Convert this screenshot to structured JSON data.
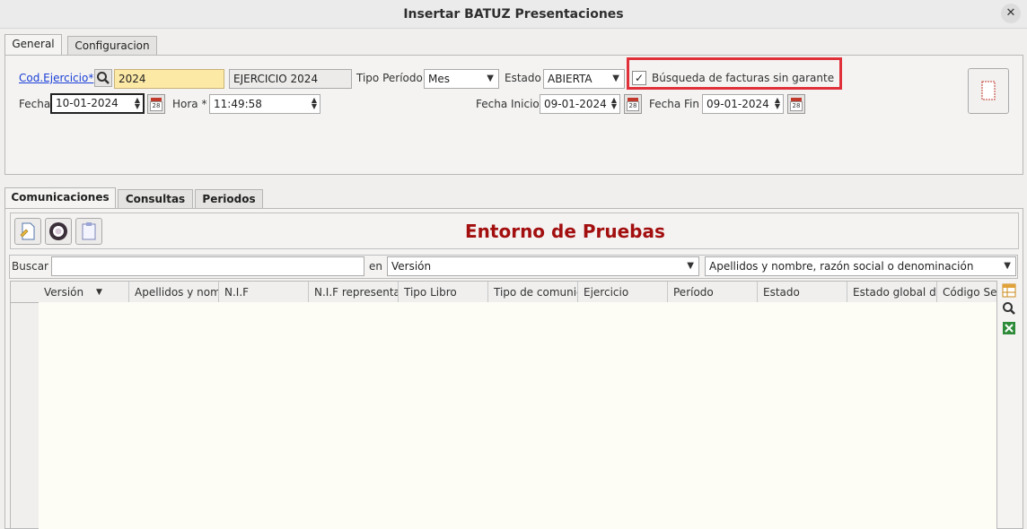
{
  "window": {
    "title": "Insertar BATUZ Presentaciones",
    "close": "✕"
  },
  "top_tabs": [
    "General",
    "Configuracion"
  ],
  "form": {
    "cod_ejercicio_label": "Cod.Ejercicio*",
    "cod_ejercicio_value": "2024",
    "ejercicio_desc": "EJERCICIO 2024",
    "tipo_periodo_label": "Tipo Período",
    "tipo_periodo_value": "Mes",
    "estado_label": "Estado",
    "estado_value": "ABIERTA",
    "busqueda_checked": "✓",
    "busqueda_label": "Búsqueda de facturas sin garante",
    "fecha_label": "Fecha",
    "fecha_value": "10-01-2024",
    "hora_label": "Hora *",
    "hora_value": "11:49:58",
    "fecha_inicio_label": "Fecha Inicio",
    "fecha_inicio_value": "09-01-2024",
    "fecha_fin_label": "Fecha Fin",
    "fecha_fin_value": "09-01-2024",
    "calendar_day": "28"
  },
  "bottom_tabs": [
    "Comunicaciones",
    "Consultas",
    "Periodos"
  ],
  "env_label": "Entorno de Pruebas",
  "search": {
    "label": "Buscar",
    "value": "",
    "en_label": "en",
    "field_value": "Versión",
    "scope_value": "Apellidos y nombre, razón social o denominación"
  },
  "grid": {
    "columns": [
      "Versión",
      "Apellidos y nom",
      "N.I.F",
      "N.I.F representa",
      "Tipo Libro",
      "Tipo de comunic",
      "Ejercicio",
      "Período",
      "Estado",
      "Estado global de",
      "Código Seg"
    ],
    "rows": []
  },
  "colors": {
    "env_text": "#a30f0f",
    "highlight_box": "#e0303a",
    "yellow_field": "#fde9a6",
    "grid_bg": "#fefdf5"
  }
}
